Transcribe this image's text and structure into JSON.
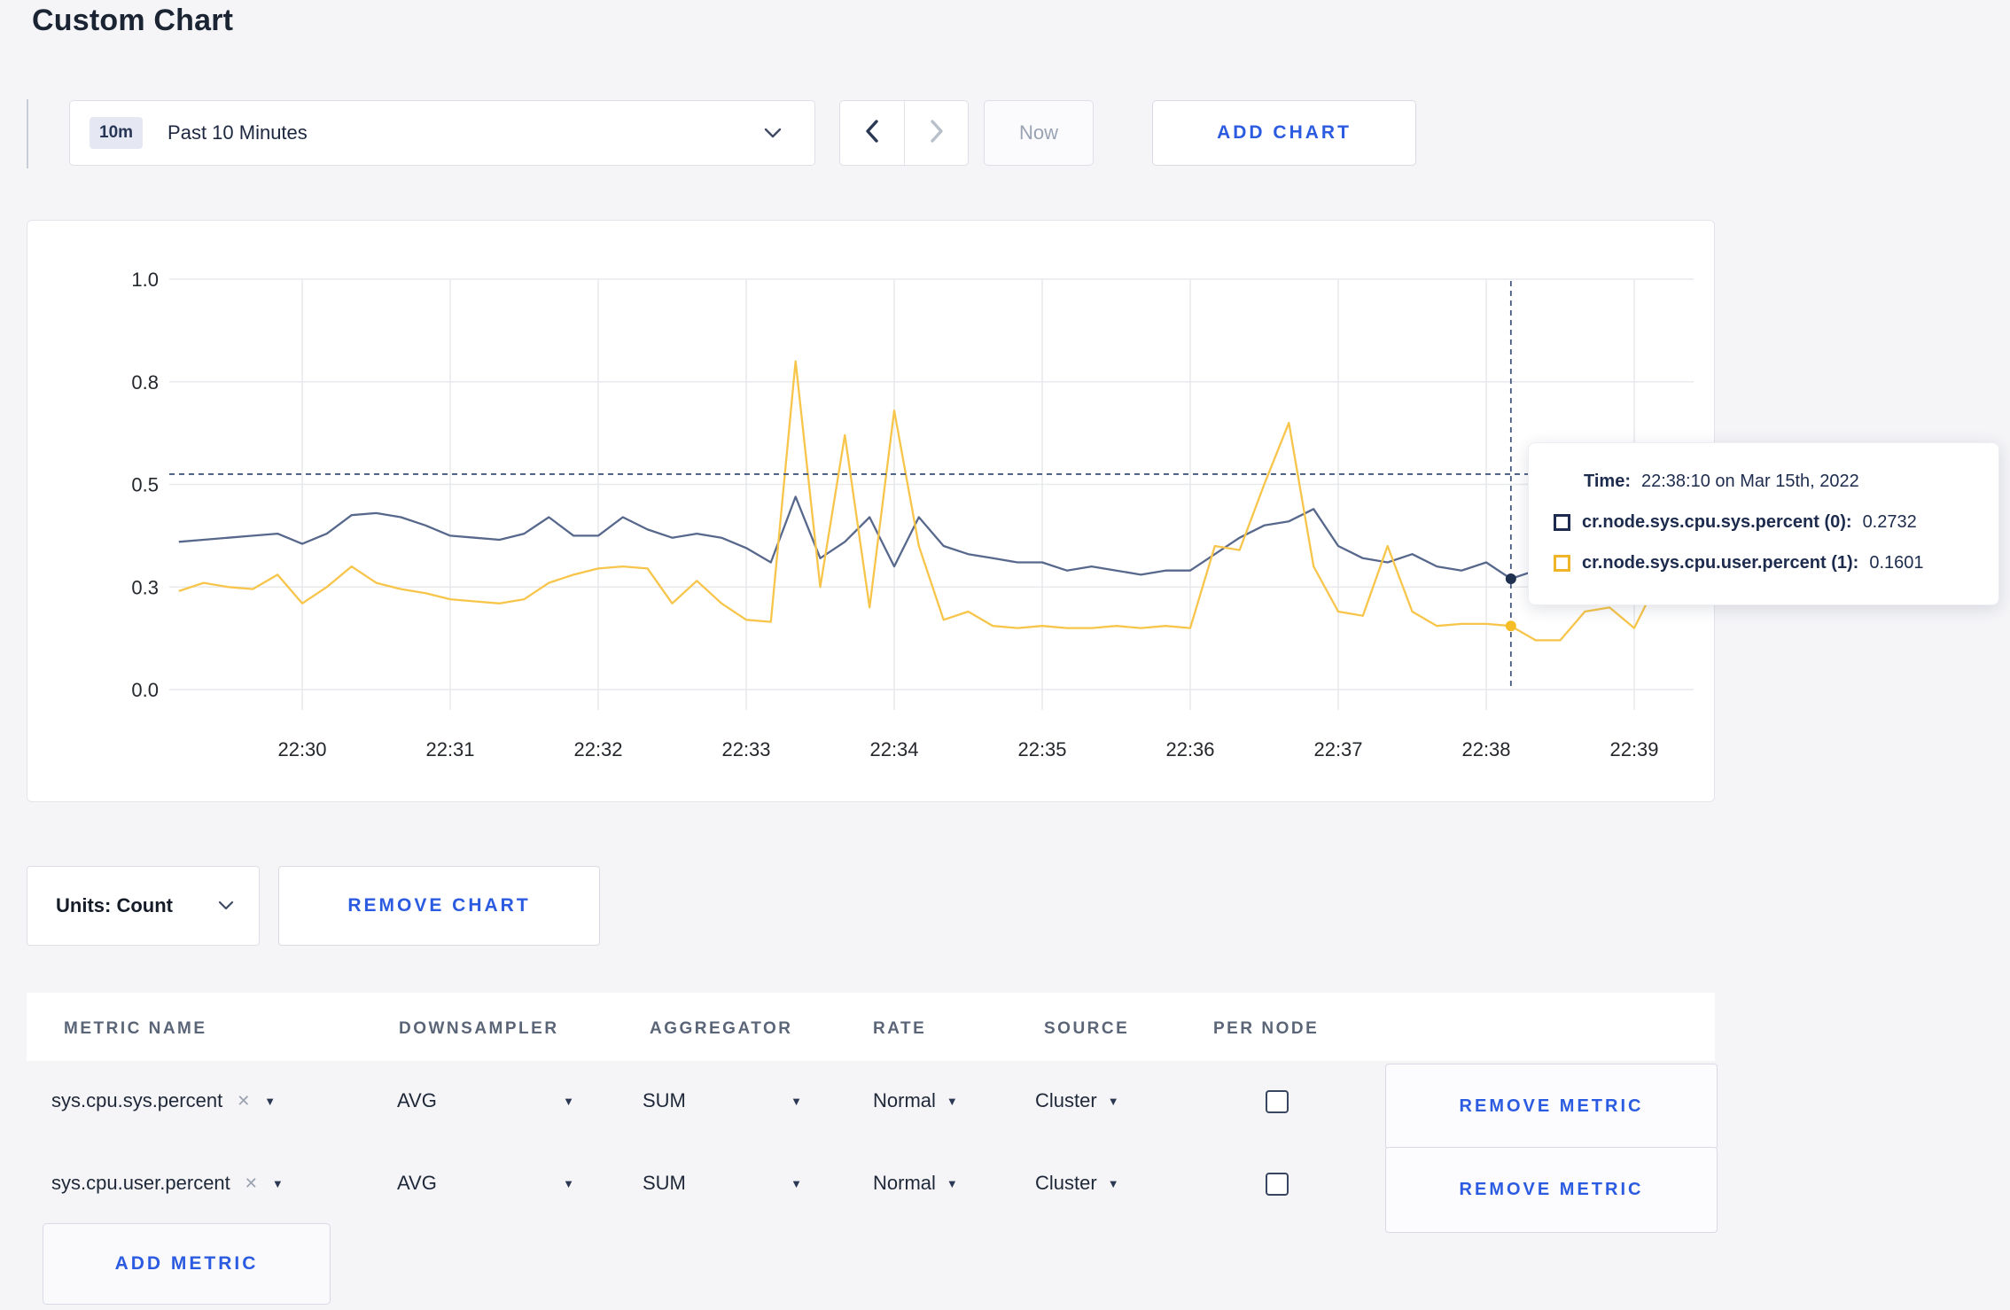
{
  "page": {
    "title": "Custom Chart"
  },
  "toolbar": {
    "timeframe": {
      "badge": "10m",
      "label": "Past 10 Minutes"
    },
    "now_label": "Now",
    "add_chart_label": "ADD CHART"
  },
  "chart_controls": {
    "units_label": "Units: Count",
    "remove_chart_label": "REMOVE CHART"
  },
  "tooltip": {
    "time_label": "Time:",
    "time_value": "22:38:10 on Mar 15th, 2022",
    "series": [
      {
        "label": "cr.node.sys.cpu.sys.percent (0):",
        "value": "0.2732",
        "color": "#1d2c4e"
      },
      {
        "label": "cr.node.sys.cpu.user.percent (1):",
        "value": "0.1601",
        "color": "#f0b429"
      }
    ]
  },
  "metrics_table": {
    "headers": [
      "METRIC NAME",
      "DOWNSAMPLER",
      "AGGREGATOR",
      "RATE",
      "SOURCE",
      "PER NODE"
    ],
    "rows": [
      {
        "name": "sys.cpu.sys.percent",
        "downsampler": "AVG",
        "aggregator": "SUM",
        "rate": "Normal",
        "source": "Cluster",
        "per_node_checked": false,
        "remove_label": "REMOVE METRIC"
      },
      {
        "name": "sys.cpu.user.percent",
        "downsampler": "AVG",
        "aggregator": "SUM",
        "rate": "Normal",
        "source": "Cluster",
        "per_node_checked": false,
        "remove_label": "REMOVE METRIC"
      }
    ],
    "add_metric_label": "ADD METRIC"
  },
  "chart_data": {
    "type": "line",
    "title": "",
    "xlabel": "",
    "ylabel": "",
    "ylim": [
      0,
      1
    ],
    "grid": true,
    "x_start": "22:29:10",
    "x_step_seconds": 10,
    "x_ticks": [
      "22:30",
      "22:31",
      "22:32",
      "22:33",
      "22:34",
      "22:35",
      "22:36",
      "22:37",
      "22:38",
      "22:39"
    ],
    "y_tick_positions": [
      0,
      0.25,
      0.5,
      0.75,
      1.0
    ],
    "y_tick_labels": [
      "0.0",
      "0.3",
      "0.5",
      "0.8",
      "1.0"
    ],
    "series": [
      {
        "name": "cr.node.sys.cpu.sys.percent (0)",
        "color": "#57688c",
        "dot_color": "#1f3050",
        "values": [
          0.36,
          0.365,
          0.37,
          0.375,
          0.38,
          0.355,
          0.38,
          0.425,
          0.43,
          0.42,
          0.4,
          0.375,
          0.37,
          0.365,
          0.38,
          0.42,
          0.375,
          0.375,
          0.42,
          0.39,
          0.37,
          0.38,
          0.37,
          0.345,
          0.31,
          0.47,
          0.32,
          0.36,
          0.42,
          0.3,
          0.42,
          0.35,
          0.33,
          0.32,
          0.31,
          0.31,
          0.29,
          0.3,
          0.29,
          0.28,
          0.29,
          0.29,
          0.33,
          0.37,
          0.4,
          0.41,
          0.44,
          0.35,
          0.32,
          0.31,
          0.33,
          0.3,
          0.29,
          0.31,
          0.27,
          0.29,
          0.3,
          0.295,
          0.3,
          0.31,
          0.3,
          0.305
        ]
      },
      {
        "name": "cr.node.sys.cpu.user.percent (1)",
        "color": "#f7c54a",
        "dot_color": "#f5bd27",
        "values": [
          0.24,
          0.26,
          0.25,
          0.245,
          0.28,
          0.21,
          0.25,
          0.3,
          0.26,
          0.245,
          0.235,
          0.22,
          0.215,
          0.21,
          0.22,
          0.26,
          0.28,
          0.295,
          0.3,
          0.295,
          0.21,
          0.265,
          0.21,
          0.17,
          0.165,
          0.8,
          0.25,
          0.62,
          0.2,
          0.68,
          0.35,
          0.17,
          0.19,
          0.155,
          0.15,
          0.155,
          0.15,
          0.15,
          0.155,
          0.15,
          0.155,
          0.15,
          0.35,
          0.34,
          0.5,
          0.65,
          0.3,
          0.19,
          0.18,
          0.35,
          0.19,
          0.155,
          0.16,
          0.16,
          0.155,
          0.12,
          0.12,
          0.19,
          0.2,
          0.15,
          0.27,
          0.215
        ]
      }
    ],
    "crosshair": {
      "time": "22:38:10",
      "x_index": 54,
      "hover_y": 0.525,
      "values_exact": [
        "0.2732",
        "0.1601"
      ]
    }
  }
}
